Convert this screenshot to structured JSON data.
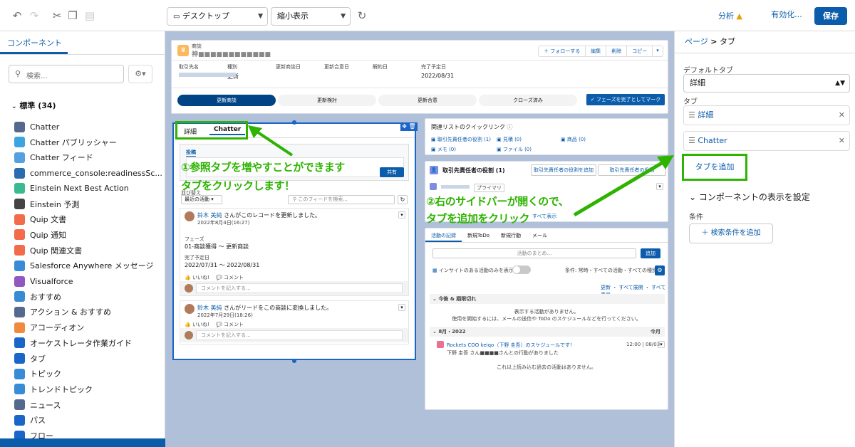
{
  "toolbar": {
    "device": "デスクトップ",
    "zoom": "縮小表示",
    "analysis": "分析",
    "activate": "有効化...",
    "save": "保存"
  },
  "left": {
    "tab": "コンポーネント",
    "search_placeholder": "検索...",
    "section": "標準 (34)",
    "items": [
      {
        "label": "Chatter",
        "color": "#54698d"
      },
      {
        "label": "Chatter パブリッシャー",
        "color": "#3ba4e1"
      },
      {
        "label": "Chatter フィード",
        "color": "#54a0e0"
      },
      {
        "label": "commerce_console:readinessSc...",
        "color": "#2b6cb0"
      },
      {
        "label": "Einstein Next Best Action",
        "color": "#3bba8f"
      },
      {
        "label": "Einstein 予測",
        "color": "#444444"
      },
      {
        "label": "Quip 文書",
        "color": "#f26b4a"
      },
      {
        "label": "Quip 通知",
        "color": "#f26b4a"
      },
      {
        "label": "Quip 関連文書",
        "color": "#f26b4a"
      },
      {
        "label": "Salesforce Anywhere メッセージ",
        "color": "#3a8bd6"
      },
      {
        "label": "Visualforce",
        "color": "#9058c0"
      },
      {
        "label": "おすすめ",
        "color": "#3a8bd6"
      },
      {
        "label": "アクション & おすすめ",
        "color": "#54698d"
      },
      {
        "label": "アコーディオン",
        "color": "#f08a3e"
      },
      {
        "label": "オーケストレータ作業ガイド",
        "color": "#1b65c8"
      },
      {
        "label": "タブ",
        "color": "#1b65c8"
      },
      {
        "label": "トピック",
        "color": "#3a8bd6"
      },
      {
        "label": "トレンドトピック",
        "color": "#3a8bd6"
      },
      {
        "label": "ニュース",
        "color": "#54698d"
      },
      {
        "label": "パス",
        "color": "#1b65c8"
      },
      {
        "label": "フロー",
        "color": "#1b65c8"
      }
    ]
  },
  "record": {
    "object": "商談",
    "name": "神■■■■■■■■■■■■",
    "actions": [
      "＋ フォローする",
      "編集",
      "削除",
      "コピー"
    ],
    "fields": [
      {
        "label": "取引先名",
        "value": ""
      },
      {
        "label": "種別",
        "value": "更新"
      },
      {
        "label": "更新商談日",
        "value": ""
      },
      {
        "label": "更新合意日",
        "value": ""
      },
      {
        "label": "解約日",
        "value": ""
      },
      {
        "label": "完了予定日",
        "value": "2022/08/31"
      }
    ],
    "path": [
      "更新商談",
      "更新検討",
      "更新合意",
      "クローズ済み"
    ],
    "complete": "✓ フェーズを完了としてマーク"
  },
  "tabs": {
    "t1": "詳細",
    "t2": "Chatter"
  },
  "feed": {
    "post_tab": "投稿",
    "share": "共有",
    "sort_label": "並び替え",
    "sort": "最近の活動",
    "search": "このフィードを検索...",
    "p1_user": "鈴木 美純",
    "p1_text": "さんがこのレコードを更新しました。",
    "p1_date": "2022年8月4日(16:27)",
    "p1_f1": "フェーズ",
    "p1_v1": "01-商談獲得 〜 更新商談",
    "p1_f2": "完了予定日",
    "p1_v2": "2022/07/31 〜 2022/08/31",
    "like": "いいね!",
    "comment": "コメント",
    "comment_ph": "コメントを記入する...",
    "p2_user": "鈴木 美純",
    "p2_text": "さんがリードをこの商談に変換しました。",
    "p2_date": "2022年7月29日(18:26)"
  },
  "related": {
    "title": "関連リストのクイックリンク",
    "links": [
      "取引先責任者の役割 (1)",
      "見積 (0)",
      "商品 (0)",
      "メモ (0)",
      "ファイル (0)"
    ],
    "contact_title": "取引先責任者の役割 (1)",
    "add_role": "取引先責任者の役割を追加",
    "edit_role": "取引先責任者の役割",
    "primary": "プライマリ",
    "show_all": "すべて表示"
  },
  "activity": {
    "tabs": [
      "活動の記録",
      "新規ToDo",
      "新規行動",
      "メール"
    ],
    "summary": "活動のまとめ...",
    "add": "追加",
    "insight": "インサイトのある活動のみを表示",
    "filter": "条件: 常時・すべての活動・すべての種別",
    "refresh": "更新 ・ すべて展開 ・ すべて表示",
    "upcoming": "今後 & 期限切れ",
    "empty1": "表示する活動がありません。",
    "empty2": "使用を開始するには、メールの送信や ToDo のスケジュールなどを行ってください。",
    "month": "8月・2022",
    "this_month": "今月",
    "ev_title": "Rockets COO keiqo（下野 圭吾）のスケジュールです！",
    "ev_time": "12:00 | 08/03",
    "ev_sub": "下野 圭吾 さん■■■■さんとの行動がありました",
    "no_more": "これ以上読み込む過去の活動はありません。"
  },
  "right": {
    "crumb_page": "ページ",
    "crumb_sep": ">",
    "crumb_cur": "タブ",
    "default_label": "デフォルトタブ",
    "default_val": "詳細",
    "tabs_label": "タブ",
    "tab1": "詳細",
    "tab2": "Chatter",
    "add_tab": "タブを追加",
    "visibility": "コンポーネントの表示を設定",
    "cond": "条件",
    "add_cond": "検索条件を追加"
  },
  "annot": {
    "a1": "①参照タブを増やすことができます",
    "a2": "タブをクリックします！",
    "a3": "②右のサイドバーが開くので、",
    "a4": "タブを追加をクリック"
  },
  "colors": {
    "brand": "#0b5cab",
    "annotation": "#2db300",
    "canvas": "#b0c0d9"
  }
}
